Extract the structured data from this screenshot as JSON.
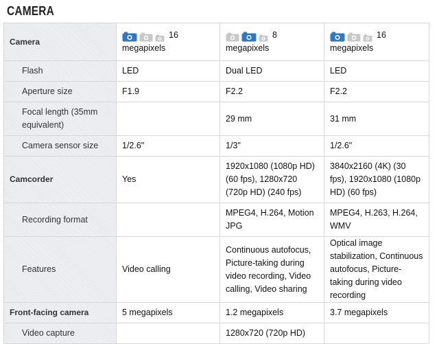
{
  "section_title": "CAMERA",
  "colors": {
    "icon_active": "#2f78c4",
    "icon_inactive": "#c8c8c8"
  },
  "camera_row": {
    "label": "Camera",
    "phones": [
      {
        "active_icon": "back",
        "megapixels": "16",
        "unit": "megapixels"
      },
      {
        "active_icon": "middle",
        "megapixels": "8",
        "unit": "megapixels"
      },
      {
        "active_icon": "back",
        "megapixels": "16",
        "unit": "megapixels"
      }
    ]
  },
  "rows": [
    {
      "label": "Flash",
      "type": "sub",
      "values": [
        "LED",
        "Dual LED",
        "LED"
      ]
    },
    {
      "label": "Aperture size",
      "type": "sub",
      "values": [
        "F1.9",
        "F2.2",
        "F2.2"
      ]
    },
    {
      "label": "Focal length (35mm equivalent)",
      "type": "sub",
      "values": [
        "",
        "29 mm",
        "31 mm"
      ]
    },
    {
      "label": "Camera sensor size",
      "type": "sub",
      "values": [
        "1/2.6\"",
        "1/3\"",
        "1/2.6\""
      ]
    },
    {
      "label": "Camcorder",
      "type": "main",
      "values": [
        "Yes",
        "1920x1080 (1080p HD) (60 fps), 1280x720 (720p HD) (240 fps)",
        "3840x2160 (4K) (30 fps), 1920x1080 (1080p HD) (60 fps)"
      ]
    },
    {
      "label": "Recording format",
      "type": "sub",
      "values": [
        "",
        "MPEG4, H.264, Motion JPG",
        "MPEG4, H.263, H.264, WMV"
      ]
    },
    {
      "label": "Features",
      "type": "sub",
      "values": [
        "Video calling",
        "Continuous autofocus, Picture-taking during video recording, Video calling, Video sharing",
        "Optical image stabilization, Continuous autofocus, Picture-taking during video recording"
      ]
    },
    {
      "label": "Front-facing camera",
      "type": "main",
      "values": [
        "5 megapixels",
        "1.2 megapixels",
        "3.7 megapixels"
      ]
    },
    {
      "label": "Video capture",
      "type": "sub",
      "values": [
        "",
        "1280x720 (720p HD)",
        ""
      ]
    }
  ]
}
